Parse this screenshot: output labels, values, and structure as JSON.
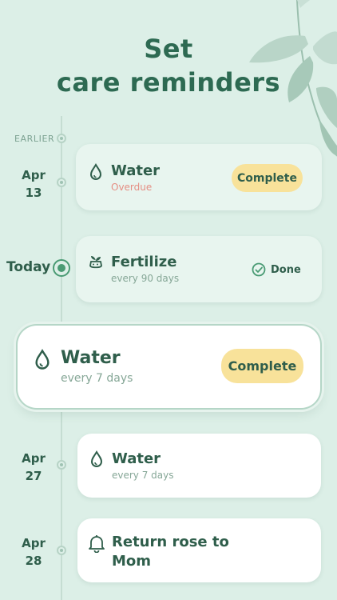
{
  "header": {
    "line1": "Set",
    "line2": "care reminders"
  },
  "timeline": {
    "earlier_label": "EARLIER",
    "today_label": "Today",
    "dates": [
      {
        "month": "Apr",
        "day": "13"
      },
      {
        "month": "Apr",
        "day": "27"
      },
      {
        "month": "Apr",
        "day": "28"
      }
    ]
  },
  "reminders": [
    {
      "title": "Water",
      "status": "Overdue",
      "action": "Complete",
      "icon": "water-drop-icon"
    },
    {
      "title": "Fertilize",
      "subtitle": "every 90 days",
      "action": "Done",
      "icon": "fertilize-icon"
    },
    {
      "title": "Water",
      "subtitle": "every 7 days",
      "action": "Complete",
      "icon": "water-drop-icon"
    },
    {
      "title": "Water",
      "subtitle": "every 7 days",
      "icon": "water-drop-icon"
    },
    {
      "title_line1": "Return rose to",
      "title_line2": "Mom",
      "icon": "bell-icon"
    }
  ],
  "colors": {
    "background": "#dcefe7",
    "accent": "#2d6a52",
    "pill": "#f8e29a",
    "overdue": "#e58f84"
  }
}
